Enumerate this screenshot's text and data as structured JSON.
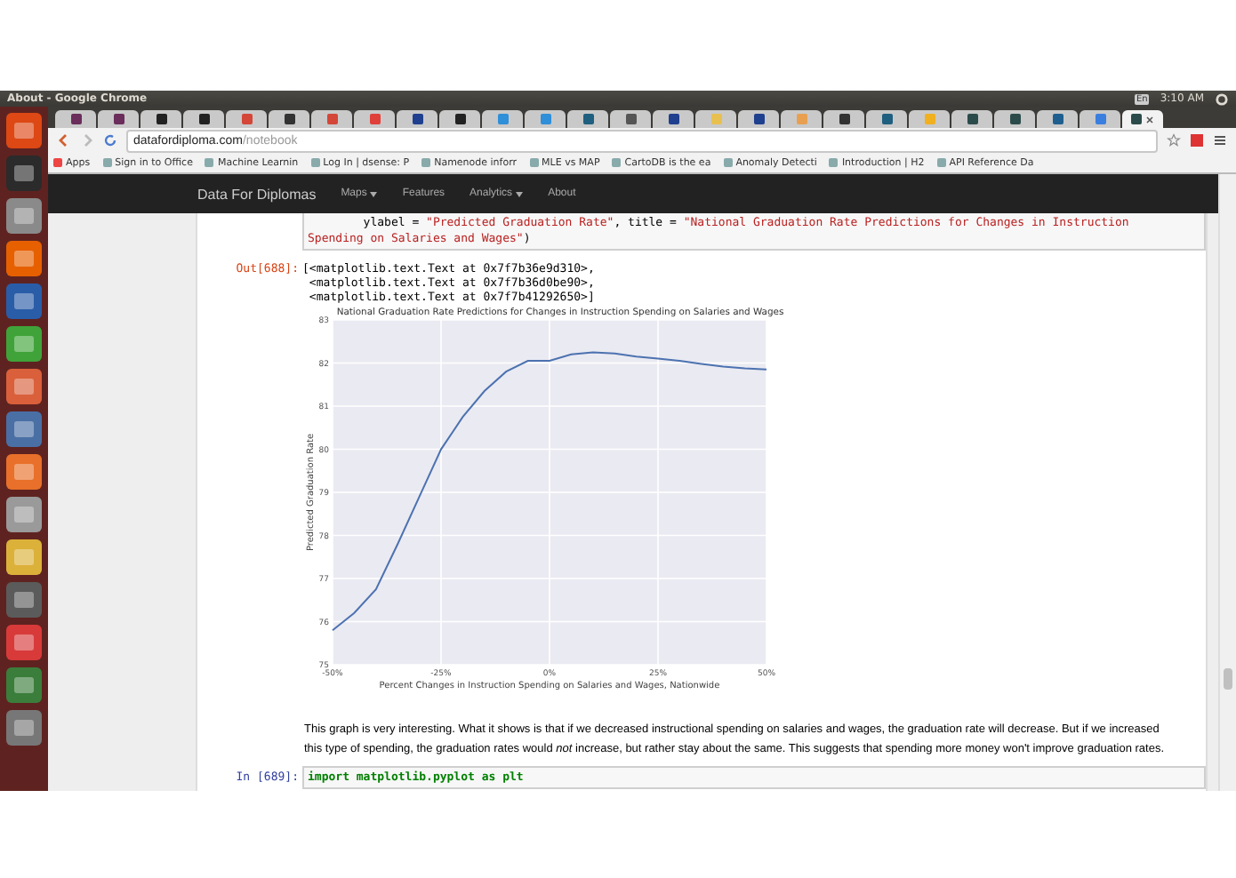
{
  "top_panel": {
    "title": "About - Google Chrome",
    "clock": "3:10 AM",
    "keyboard": "En"
  },
  "launcher": [
    {
      "color": "#dd4814"
    },
    {
      "color": "#2b2b2b"
    },
    {
      "color": "#8a8a8a"
    },
    {
      "color": "#e66000"
    },
    {
      "color": "#2a5da8"
    },
    {
      "color": "#3fa33a"
    },
    {
      "color": "#d9603b"
    },
    {
      "color": "#4a6fa5"
    },
    {
      "color": "#e8702a"
    },
    {
      "color": "#9a9a9a"
    },
    {
      "color": "#dcb13a"
    },
    {
      "color": "#5b5b5b"
    },
    {
      "color": "#d83a3a"
    },
    {
      "color": "#3b7d3b"
    },
    {
      "color": "#777777"
    }
  ],
  "tabs": [
    {
      "color": "#6b2d5c",
      "selected": false
    },
    {
      "color": "#6b2d5c",
      "selected": false
    },
    {
      "color": "#222222",
      "selected": false
    },
    {
      "color": "#222222",
      "selected": false
    },
    {
      "color": "#d44638",
      "selected": false
    },
    {
      "color": "#333333",
      "selected": false
    },
    {
      "color": "#d44638",
      "selected": false
    },
    {
      "color": "#e0403a",
      "selected": false
    },
    {
      "color": "#1f3f8f",
      "selected": false
    },
    {
      "color": "#222222",
      "selected": false
    },
    {
      "color": "#2f8fd8",
      "selected": false
    },
    {
      "color": "#2f8fd8",
      "selected": false
    },
    {
      "color": "#1f5f7f",
      "selected": false
    },
    {
      "color": "#555555",
      "selected": false
    },
    {
      "color": "#1f3f8f",
      "selected": false
    },
    {
      "color": "#e8c050",
      "selected": false
    },
    {
      "color": "#1f3f8f",
      "selected": false
    },
    {
      "color": "#e8a050",
      "selected": false
    },
    {
      "color": "#333333",
      "selected": false
    },
    {
      "color": "#1f5f7f",
      "selected": false
    },
    {
      "color": "#f0b020",
      "selected": false
    },
    {
      "color": "#2b4b4b",
      "selected": false
    },
    {
      "color": "#2b4b4b",
      "selected": false
    },
    {
      "color": "#1f5f8f",
      "selected": false
    },
    {
      "color": "#3a7fe0",
      "selected": false
    },
    {
      "color": "#2b4b4b",
      "selected": true
    }
  ],
  "address": {
    "host": "datafordiploma.com",
    "path": "/notebook"
  },
  "bookmarks": [
    "Apps",
    "Sign in to Office",
    "Machine Learnin",
    "Log In | dsense: P",
    "Namenode inforr",
    "MLE vs MAP",
    "CartoDB is the ea",
    "Anomaly Detecti",
    "Introduction | H2",
    "API Reference Da"
  ],
  "navbar": {
    "brand": "Data For Diplomas",
    "items": [
      {
        "label": "Maps",
        "dropdown": true
      },
      {
        "label": "Features",
        "dropdown": false
      },
      {
        "label": "Analytics",
        "dropdown": true
      },
      {
        "label": "About",
        "dropdown": false
      }
    ]
  },
  "code_cell_1": {
    "lines": [
      {
        "plain": "        ylabel = ",
        "string": "\"Predicted Graduation Rate\"",
        "plain2": ", title = ",
        "string2": "\"National Graduation Rate Predictions for Changes in Instruction"
      },
      {
        "string": "Spending on Salaries and Wages\"",
        "plain2": ")"
      }
    ]
  },
  "output_cell": {
    "prompt": "Out[688]:",
    "lines": [
      "[<matplotlib.text.Text at 0x7f7b36e9d310>,",
      " <matplotlib.text.Text at 0x7f7b36d0be90>,",
      " <matplotlib.text.Text at 0x7f7b41292650>]"
    ],
    "chart_data": {
      "type": "line",
      "title": "National Graduation Rate Predictions for Changes in Instruction Spending on Salaries and Wages",
      "xlabel": "Percent Changes in Instruction Spending on Salaries and Wages, Nationwide",
      "ylabel": "Predicted Graduation Rate",
      "x": [
        -50,
        -45,
        -40,
        -35,
        -30,
        -25,
        -20,
        -15,
        -10,
        -5,
        0,
        5,
        10,
        15,
        20,
        25,
        30,
        35,
        40,
        45,
        50
      ],
      "grid": true,
      "series": [
        {
          "color": "#4c72b0",
          "values": [
            75.8,
            76.2,
            76.75,
            77.8,
            78.9,
            80.0,
            80.75,
            81.35,
            81.8,
            82.05,
            82.05,
            82.2,
            82.25,
            82.22,
            82.15,
            82.1,
            82.05,
            81.98,
            81.92,
            81.88,
            81.85
          ]
        }
      ],
      "xlim": [
        -50,
        50
      ],
      "ylim": [
        75,
        83
      ],
      "xticks": [
        {
          "value": -50,
          "label": "-50%"
        },
        {
          "value": -25,
          "label": "-25%"
        },
        {
          "value": 0,
          "label": "0%"
        },
        {
          "value": 25,
          "label": "25%"
        },
        {
          "value": 50,
          "label": "50%"
        }
      ],
      "yticks": [
        75,
        76,
        77,
        78,
        79,
        80,
        81,
        82,
        83
      ]
    }
  },
  "markdown_cell": {
    "text": "This graph is very interesting. What it shows is that if we decreased instructional spending on salaries and wages, the graduation rate will decrease. But if we increased this type of spending, the graduation rates would *not* increase, but rather stay about the same. This suggests that spending more money won't improve graduation rates."
  },
  "code_cell_2": {
    "prompt": "In [689]:",
    "code": "import matplotlib.pyplot as plt"
  }
}
